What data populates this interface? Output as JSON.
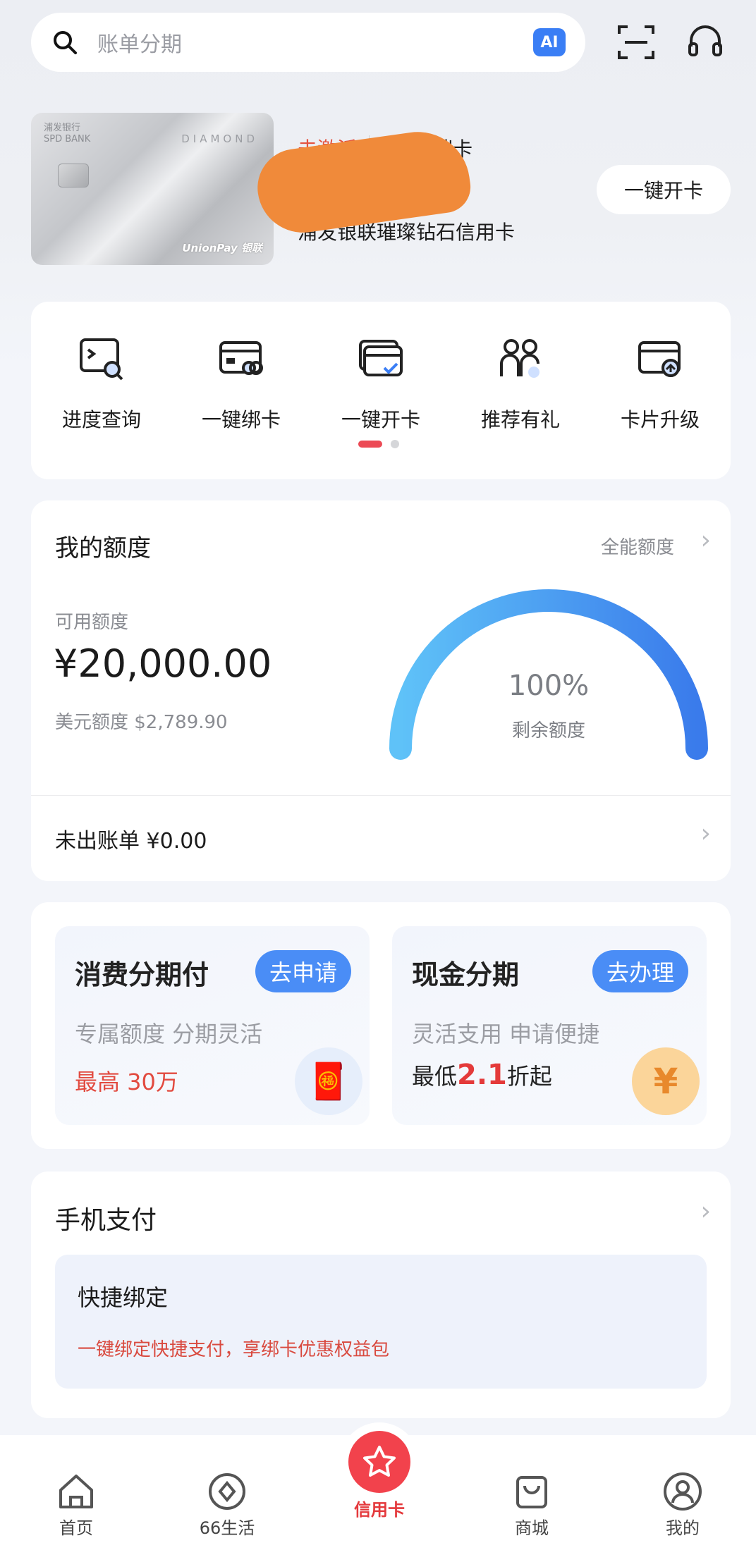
{
  "search": {
    "placeholder": "账单分期",
    "ai_badge": "AI"
  },
  "card": {
    "bank_cn": "浦发银行",
    "bank_en": "SPD BANK",
    "edition": "DIAMOND",
    "network": "UnionPay 银联",
    "status": "未激活",
    "tier": "高端卡",
    "name": "浦发银联璀璨钻石信用卡",
    "open_button": "一键开卡"
  },
  "shortcuts": [
    {
      "label": "进度查询",
      "icon": "progress-search-icon"
    },
    {
      "label": "一键绑卡",
      "icon": "bind-card-icon"
    },
    {
      "label": "一键开卡",
      "icon": "activate-card-icon"
    },
    {
      "label": "推荐有礼",
      "icon": "referral-icon"
    },
    {
      "label": "卡片升级",
      "icon": "card-upgrade-icon"
    }
  ],
  "quota": {
    "title": "我的额度",
    "link": "全能额度",
    "available_label": "可用额度",
    "available_amount": "¥20,000.00",
    "usd_quota": "美元额度 $2,789.90",
    "remaining_percent": "100%",
    "remaining_fraction": 1.0,
    "remaining_label": "剩余额度",
    "unbilled": "未出账单 ¥0.00"
  },
  "installments": [
    {
      "title": "消费分期付",
      "button": "去申请",
      "subtitle": "专属额度 分期灵活",
      "highlight": "最高 30万"
    },
    {
      "title": "现金分期",
      "button": "去办理",
      "subtitle": "灵活支用 申请便捷",
      "prefix": "最低",
      "rate": "2.1",
      "suffix": "折起"
    }
  ],
  "mobile_pay": {
    "title": "手机支付",
    "inner_title": "快捷绑定",
    "inner_subtitle": "一键绑定快捷支付，享绑卡优惠权益包"
  },
  "tabs": [
    {
      "label": "首页",
      "icon": "home-icon"
    },
    {
      "label": "66生活",
      "icon": "life-icon"
    },
    {
      "label": "信用卡",
      "icon": "star-icon"
    },
    {
      "label": "商城",
      "icon": "shopping-bag-icon"
    },
    {
      "label": "我的",
      "icon": "profile-icon"
    }
  ],
  "colors": {
    "accent_red": "#E4393C",
    "accent_blue": "#3A7EF5",
    "gauge_start": "#5FC2F8",
    "gauge_end": "#3A7BEB"
  }
}
